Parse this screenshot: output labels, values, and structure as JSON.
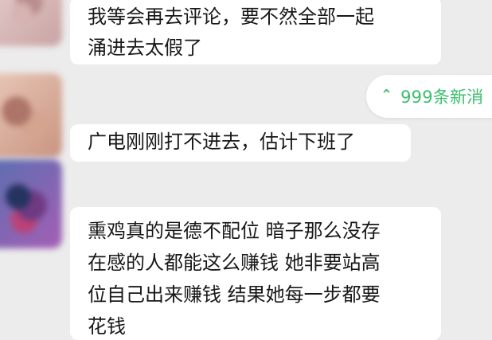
{
  "colors": {
    "background": "#ececec",
    "bubble": "#ffffff",
    "text": "#181818",
    "accent": "#3bbf6f"
  },
  "chat": {
    "messages": [
      {
        "text": "我等会再去评论，要不然全部一起\n涌进去太假了"
      },
      {
        "text": "广电刚刚打不进去，估计下班了"
      },
      {
        "text": "熏鸡真的是德不配位 暗子那么没存\n在感的人都能这么赚钱 她非要站高\n位自己出来赚钱 结果她每一步都要\n花钱"
      }
    ],
    "new_messages_indicator": {
      "icon": "double-chevron-up-icon",
      "label": "999条新消"
    }
  }
}
